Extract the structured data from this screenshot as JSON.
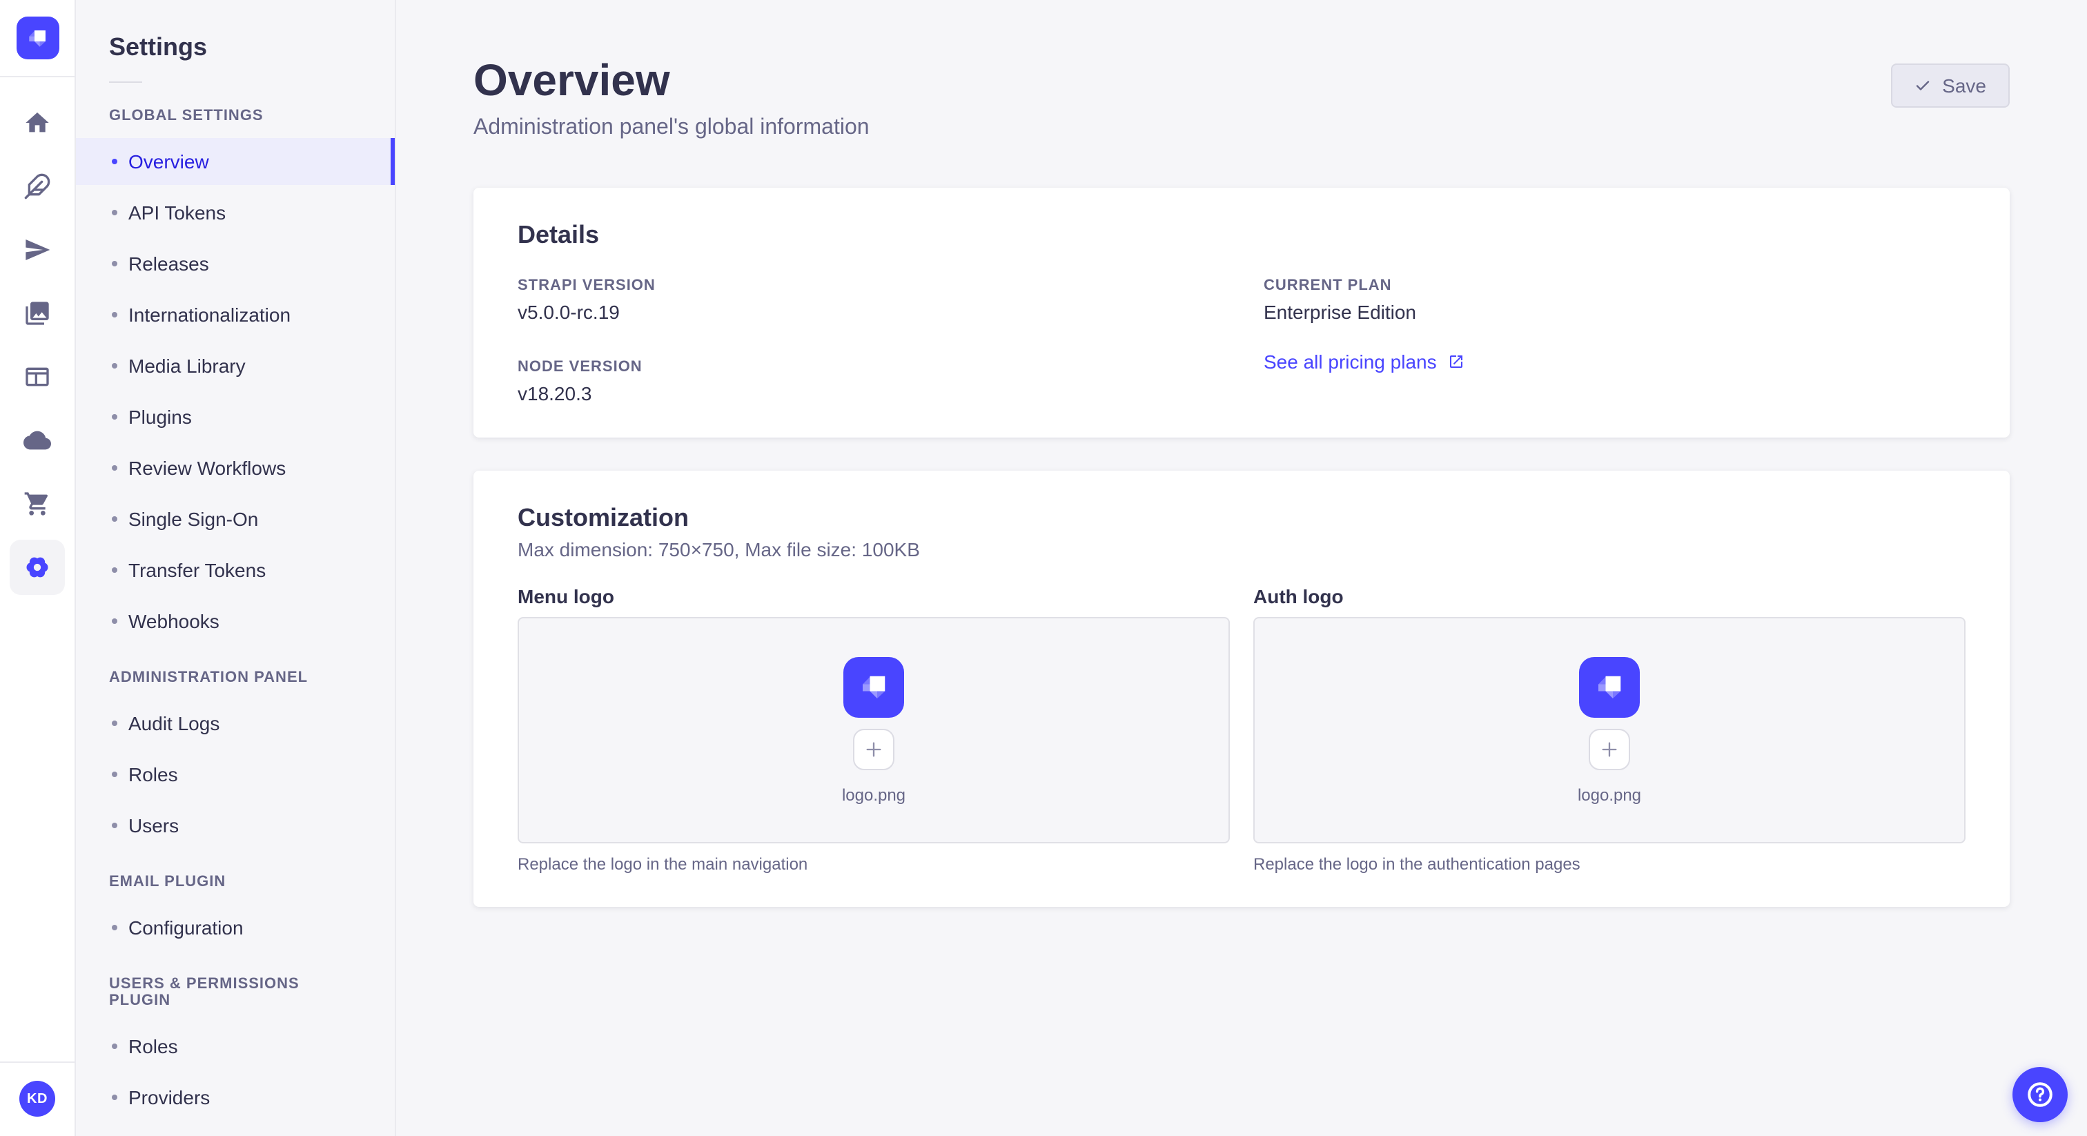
{
  "brand": {
    "accent_color": "#4945FF",
    "selected_bg": "#EDEDFC",
    "text_dark": "#32324D",
    "text_muted": "#666687"
  },
  "icon_rail": {
    "logo_icon": "strapi-logo",
    "nav_icons": [
      "home-icon",
      "feather-icon",
      "send-icon",
      "media-library-icon",
      "content-layout-icon",
      "cloud-icon",
      "marketplace-cart-icon",
      "settings-gear-icon"
    ],
    "active_icon": "settings-gear-icon",
    "avatar_initials": "KD"
  },
  "subnav": {
    "title": "Settings",
    "sections": [
      {
        "label": "GLOBAL SETTINGS",
        "items": [
          {
            "label": "Overview",
            "selected": true
          },
          {
            "label": "API Tokens",
            "selected": false
          },
          {
            "label": "Releases",
            "selected": false
          },
          {
            "label": "Internationalization",
            "selected": false
          },
          {
            "label": "Media Library",
            "selected": false
          },
          {
            "label": "Plugins",
            "selected": false
          },
          {
            "label": "Review Workflows",
            "selected": false
          },
          {
            "label": "Single Sign-On",
            "selected": false
          },
          {
            "label": "Transfer Tokens",
            "selected": false
          },
          {
            "label": "Webhooks",
            "selected": false
          }
        ]
      },
      {
        "label": "ADMINISTRATION PANEL",
        "items": [
          {
            "label": "Audit Logs"
          },
          {
            "label": "Roles"
          },
          {
            "label": "Users"
          }
        ]
      },
      {
        "label": "EMAIL PLUGIN",
        "items": [
          {
            "label": "Configuration"
          }
        ]
      },
      {
        "label": "USERS & PERMISSIONS PLUGIN",
        "items": [
          {
            "label": "Roles"
          },
          {
            "label": "Providers"
          }
        ]
      }
    ]
  },
  "header": {
    "title": "Overview",
    "subtitle": "Administration panel's global information",
    "save_label": "Save",
    "save_icon": "check-icon"
  },
  "details_card": {
    "title": "Details",
    "strapi_version": {
      "label": "STRAPI VERSION",
      "value": "v5.0.0-rc.19"
    },
    "current_plan": {
      "label": "CURRENT PLAN",
      "value": "Enterprise Edition"
    },
    "node_version": {
      "label": "NODE VERSION",
      "value": "v18.20.3"
    },
    "pricing_link": {
      "label": "See all pricing plans",
      "icon": "external-link-icon"
    }
  },
  "customization_card": {
    "title": "Customization",
    "subtitle": "Max dimension: 750×750, Max file size: 100KB",
    "menu_logo": {
      "label": "Menu logo",
      "filename": "logo.png",
      "caption": "Replace the logo in the main navigation",
      "add_icon": "plus-icon",
      "logo_icon": "strapi-logo"
    },
    "auth_logo": {
      "label": "Auth logo",
      "filename": "logo.png",
      "caption": "Replace the logo in the authentication pages",
      "add_icon": "plus-icon",
      "logo_icon": "strapi-logo"
    }
  },
  "fab": {
    "icon": "help-icon"
  }
}
